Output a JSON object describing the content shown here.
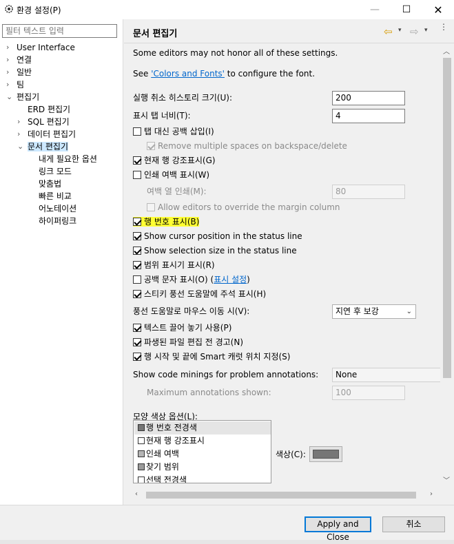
{
  "window": {
    "title": "환경 설정(P)",
    "min_glyph": "—",
    "max_glyph": "☐",
    "close_glyph": "✕"
  },
  "filter": {
    "placeholder": "필터 텍스트 입력"
  },
  "tree": [
    {
      "label": "User Interface",
      "chev": "›"
    },
    {
      "label": "연결",
      "chev": "›"
    },
    {
      "label": "일반",
      "chev": "›"
    },
    {
      "label": "팀",
      "chev": "›"
    },
    {
      "label": "편집기",
      "chev": "⌄"
    },
    {
      "label": "ERD 편집기",
      "chev": ""
    },
    {
      "label": "SQL 편집기",
      "chev": "›"
    },
    {
      "label": "데이터 편집기",
      "chev": "›"
    },
    {
      "label": "문서 편집기",
      "chev": "⌄"
    },
    {
      "label": "내게 필요한 옵션",
      "chev": ""
    },
    {
      "label": "링크 모드",
      "chev": ""
    },
    {
      "label": "맞춤법",
      "chev": ""
    },
    {
      "label": "빠른 비교",
      "chev": ""
    },
    {
      "label": "어노테이션",
      "chev": ""
    },
    {
      "label": "하이퍼링크",
      "chev": ""
    }
  ],
  "page": {
    "title": "문서 편집기",
    "nav_back_icon": "⇦",
    "nav_forward_icon": "⇨",
    "dropdown_glyph": "▾",
    "menu_glyph": "⋮"
  },
  "settings": {
    "note": "Some editors may not honor all of these settings.",
    "see_prefix": "See ",
    "see_link": "'Colors and Fonts'",
    "see_suffix": " to configure the font.",
    "undo_history_label": "실행 취소 히스토리 크기(U):",
    "undo_history_value": "200",
    "tab_width_label": "표시 탭 너비(T):",
    "tab_width_value": "4",
    "insert_spaces": {
      "label": "탭 대신 공백 삽입(I)",
      "checked": false
    },
    "remove_spaces": {
      "label": "Remove multiple spaces on backspace/delete",
      "checked": true
    },
    "highlight_line": {
      "label": "현재 행 강조표시(G)",
      "checked": true
    },
    "print_margin": {
      "label": "인쇄 여백 표시(W)",
      "checked": false
    },
    "margin_column_label": "여백 열 인쇄(M):",
    "margin_column_value": "80",
    "allow_override_margin": {
      "label": "Allow editors to override the margin column",
      "checked": false
    },
    "line_numbers": {
      "label": "행 번호 표시(B)",
      "checked": true
    },
    "cursor_position": {
      "label": "Show cursor position in the status line",
      "checked": true
    },
    "selection_size": {
      "label": "Show selection size in the status line",
      "checked": true
    },
    "range_indicator": {
      "label": "범위 표시기 표시(R)",
      "checked": true
    },
    "whitespace": {
      "label": "공백 문자 표시(O) (",
      "link": "표시 설정",
      "suffix": ")",
      "checked": false
    },
    "sticky_hover": {
      "label": "스티키 풍선 도움말에 주석 표시(H)",
      "checked": true
    },
    "hover_label": "풍선 도움말로 마우스 이동 시(V):",
    "hover_value": "지연 후 보강",
    "drag_drop": {
      "label": "텍스트 끌어 놓기 사용(P)",
      "checked": true
    },
    "derived_warning": {
      "label": "파생된 파일 편집 전 경고(N)",
      "checked": true
    },
    "smart_caret": {
      "label": "행 시작 및 끝에 Smart 캐럿 위치 지정(S)",
      "checked": true
    },
    "code_minings_label": "Show code minings for problem annotations:",
    "code_minings_value": "None",
    "max_annotations_label": "Maximum annotations shown:",
    "max_annotations_value": "100",
    "appearance_label": "모양 색상 옵션(L):",
    "appearance_items": [
      {
        "label": "행 번호 전경색",
        "swatch": "#767676",
        "selected": true
      },
      {
        "label": "현재 행 강조표시",
        "swatch": "#ffffff",
        "selected": false
      },
      {
        "label": "인쇄 여백",
        "swatch": "#b4b4b4",
        "selected": false
      },
      {
        "label": "찾기 범위",
        "swatch": "#9a9a9a",
        "selected": false
      },
      {
        "label": "선택 전경색",
        "swatch": "#ffffff",
        "selected": false
      }
    ],
    "color_label": "색상(C):",
    "color_value": "#767676"
  },
  "footer": {
    "apply_close": "Apply and Close",
    "cancel": "취소"
  }
}
